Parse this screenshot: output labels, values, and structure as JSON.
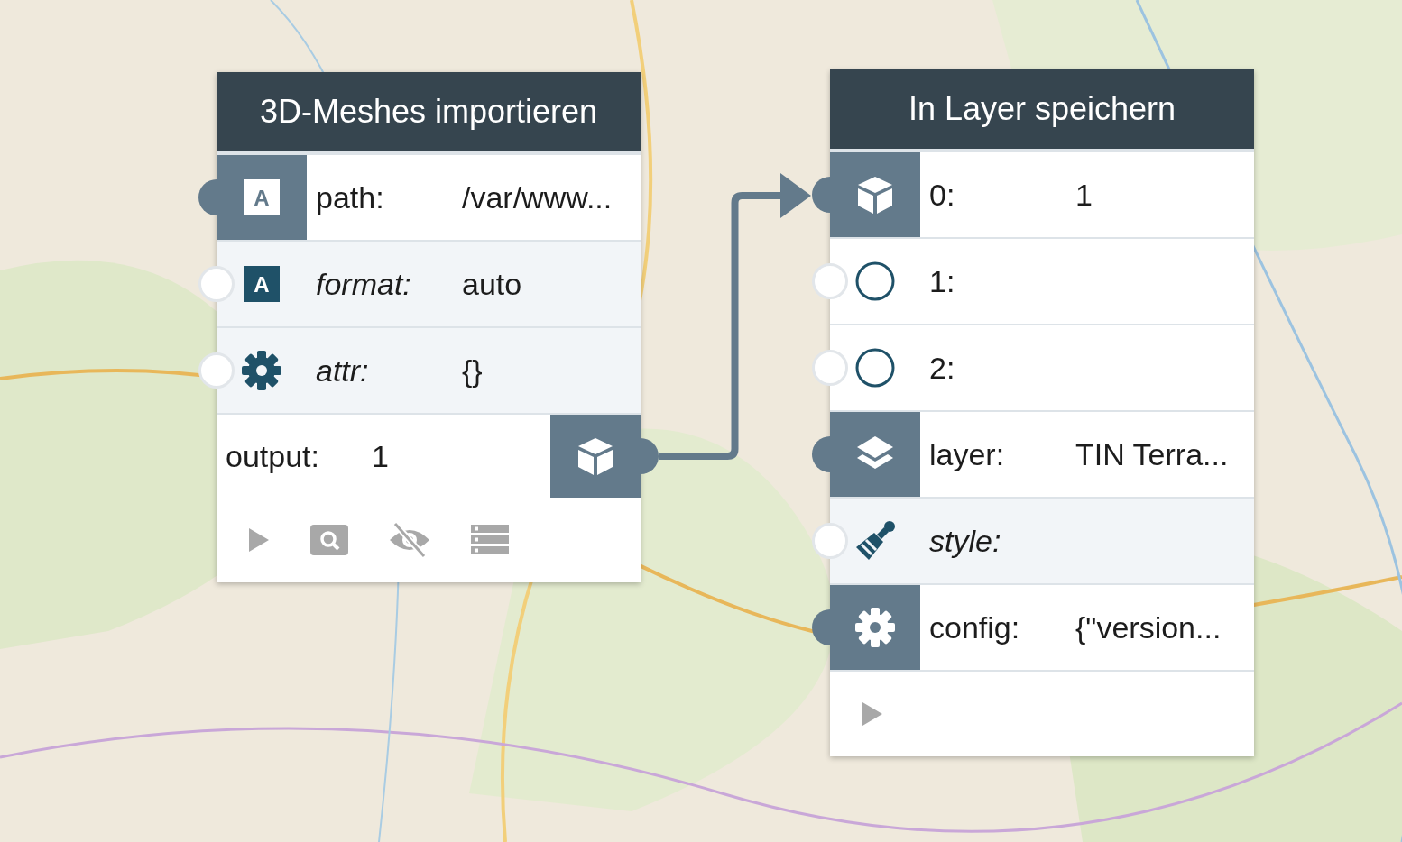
{
  "nodes": [
    {
      "title": "3D-Meshes importieren",
      "inputs": [
        {
          "kind": "text",
          "badge": "A",
          "label": "path:",
          "value": "/var/www...",
          "connected": true,
          "optional": false
        },
        {
          "kind": "text",
          "badge": "A",
          "label": "format:",
          "value": "auto",
          "connected": false,
          "optional": true
        },
        {
          "kind": "gear",
          "label": "attr:",
          "value": "{}",
          "connected": false,
          "optional": true
        }
      ],
      "outputs": [
        {
          "kind": "cube",
          "label": "output:",
          "value": "1",
          "connected": true
        }
      ],
      "toolbar": [
        {
          "kind": "run"
        },
        {
          "kind": "inspect"
        },
        {
          "kind": "hide"
        },
        {
          "kind": "list"
        }
      ]
    },
    {
      "title": "In Layer speichern",
      "inputs": [
        {
          "kind": "cube",
          "label": "0:",
          "value": "1",
          "connected": true,
          "optional": false
        },
        {
          "kind": "circle",
          "label": "1:",
          "connected": false,
          "optional": false
        },
        {
          "kind": "circle",
          "label": "2:",
          "connected": false,
          "optional": false
        },
        {
          "kind": "layers",
          "label": "layer:",
          "value": "TIN Terra...",
          "connected": true,
          "optional": false
        },
        {
          "kind": "brush",
          "label": "style:",
          "connected": false,
          "optional": true
        },
        {
          "kind": "gear",
          "label": "config:",
          "value": "{\"version...",
          "connected": true,
          "optional": false
        }
      ],
      "toolbar": [
        {
          "kind": "run"
        }
      ]
    }
  ]
}
